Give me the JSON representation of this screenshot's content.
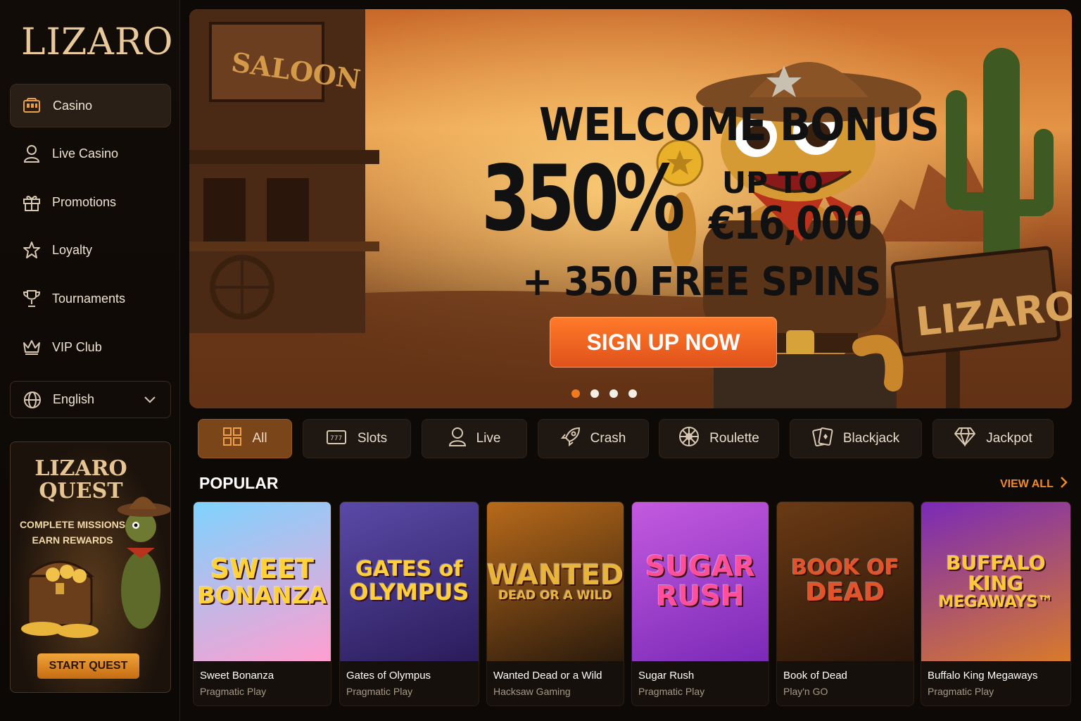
{
  "brand": {
    "name": "LIZARO"
  },
  "sidebar": {
    "items": [
      {
        "label": "Casino",
        "icon": "slot-machine-icon",
        "active": true
      },
      {
        "label": "Live Casino",
        "icon": "user-icon"
      },
      {
        "label": "Promotions",
        "icon": "gift-icon"
      },
      {
        "label": "Loyalty",
        "icon": "star-icon"
      },
      {
        "label": "Tournaments",
        "icon": "trophy-icon"
      },
      {
        "label": "VIP Club",
        "icon": "crown-icon"
      }
    ],
    "language": {
      "label": "English",
      "icon": "globe-icon"
    },
    "quest": {
      "title_line1": "LIZARO",
      "title_line2": "QUEST",
      "sub_line1": "COMPLETE MISSIONS",
      "sub_line2": "EARN REWARDS",
      "button": "START QUEST"
    }
  },
  "hero": {
    "headline": "WELCOME BONUS",
    "percent": "350%",
    "up_to": "UP TO",
    "amount": "€16,000",
    "spins": "+ 350 FREE SPINS",
    "cta": "SIGN UP NOW",
    "saloon_sign": "SALOON",
    "wood_sign": "LIZARO",
    "slides": 4,
    "active_slide": 1
  },
  "categories": [
    {
      "label": "All",
      "icon": "grid-icon",
      "active": true
    },
    {
      "label": "Slots",
      "icon": "slot-machine-icon"
    },
    {
      "label": "Live",
      "icon": "user-icon"
    },
    {
      "label": "Crash",
      "icon": "rocket-icon"
    },
    {
      "label": "Roulette",
      "icon": "roulette-icon"
    },
    {
      "label": "Blackjack",
      "icon": "cards-icon"
    },
    {
      "label": "Jackpot",
      "icon": "diamond-icon"
    }
  ],
  "section": {
    "title": "POPULAR",
    "view_all": "VIEW ALL"
  },
  "games": [
    {
      "name": "Sweet Bonanza",
      "provider": "Pragmatic Play",
      "art_l1": "SWEET",
      "art_l2": "BONANZA",
      "bg1": "#7fd3ff",
      "bg2": "#ff9ecf",
      "fg": "#ffd23a"
    },
    {
      "name": "Gates of Olympus",
      "provider": "Pragmatic Play",
      "art_l1": "GATES of",
      "art_l2": "OLYMPUS",
      "bg1": "#5a4aa8",
      "bg2": "#2a1c5a",
      "fg": "#ffcf3a"
    },
    {
      "name": "Wanted Dead or a Wild",
      "provider": "Hacksaw Gaming",
      "art_l1": "WANTED",
      "art_l2": "DEAD OR A WILD",
      "bg1": "#b86a1a",
      "bg2": "#2a1a0c",
      "fg": "#e8b43a"
    },
    {
      "name": "Sugar Rush",
      "provider": "Pragmatic Play",
      "art_l1": "SUGAR",
      "art_l2": "RUSH",
      "bg1": "#c45adf",
      "bg2": "#7a2ab8",
      "fg": "#ff4f9a"
    },
    {
      "name": "Book of Dead",
      "provider": "Play'n GO",
      "art_l1": "BOOK OF",
      "art_l2": "DEAD",
      "bg1": "#6a3a14",
      "bg2": "#2a160a",
      "fg": "#e2532a"
    },
    {
      "name": "Buffalo King Megaways",
      "provider": "Pragmatic Play",
      "art_l1": "BUFFALO KING",
      "art_l2": "MEGAWAYS™",
      "bg1": "#7a2ab8",
      "bg2": "#d87a2a",
      "fg": "#ffc83a"
    }
  ]
}
